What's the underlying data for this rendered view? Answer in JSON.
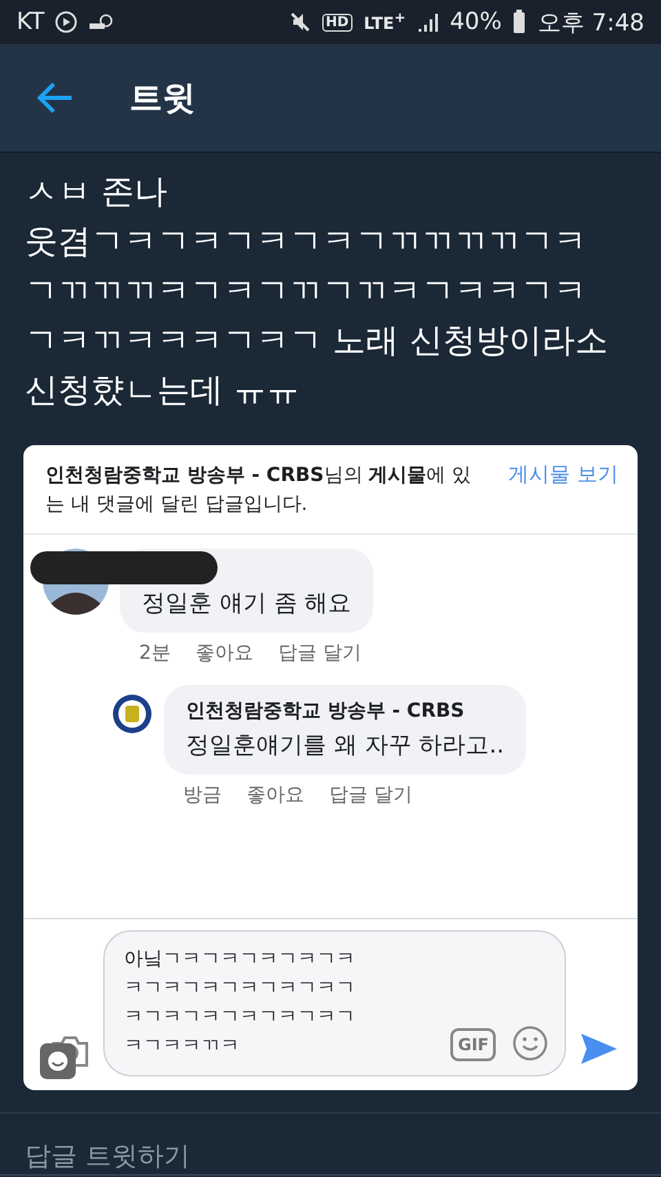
{
  "status_bar": {
    "carrier": "KT",
    "hd": "HD",
    "network": "LTE$^{+}$",
    "battery": "40%",
    "time": "오후 7:48"
  },
  "header": {
    "title": "트윗"
  },
  "tweet": {
    "lines": [
      "ㅅㅂ 존나",
      "웃겸ㄱㅋㄱㅋㄱㅋㄱㅋㄱㄲㄲㄲㄲㄱㅋ",
      "ㄱㄲㄲㄲㅋㄱㅋㄱㄲㄱㄲㅋㄱㅋㅋㄱㅋ",
      "ㄱㅋㄲㅋㅋㅋㄱㅋㄱ 노래 신청방이라소",
      "신청햤ㄴ는데 ㅠㅠ"
    ]
  },
  "embed": {
    "notice": "**인천청람중학교 방송부 - CRBS**님의 **게시물**에 있는 내 댓글에 달린 답글입니다.",
    "view_post": "게시물 보기",
    "comments": [
      {
        "kind": "comment",
        "text": "정일훈 얘기 좀 해요",
        "meta": [
          "2분",
          "좋아요",
          "답글 달기"
        ]
      },
      {
        "kind": "reply",
        "author": "인천청람중학교 방송부 - CRBS",
        "text": "정일훈얘기를 왜 자꾸 하라고..",
        "meta": [
          "방금",
          "좋아요",
          "답글 달기"
        ]
      }
    ],
    "composer": {
      "lines": [
        "아닠ㄱㅋㄱㅋㄱㅋㄱㅋㄱㅋ",
        "ㅋㄱㅋㄱㅋㄱㅋㄱㅋㄱㅋㄱ",
        "ㅋㄱㅋㄱㅋㄱㅋㄱㅋㄱㅋㄱ",
        "ㅋㄱㅋㅋㄲㅋ"
      ],
      "gif": "GIF"
    }
  },
  "reply_bar": {
    "placeholder": "답글 트윗하기"
  }
}
